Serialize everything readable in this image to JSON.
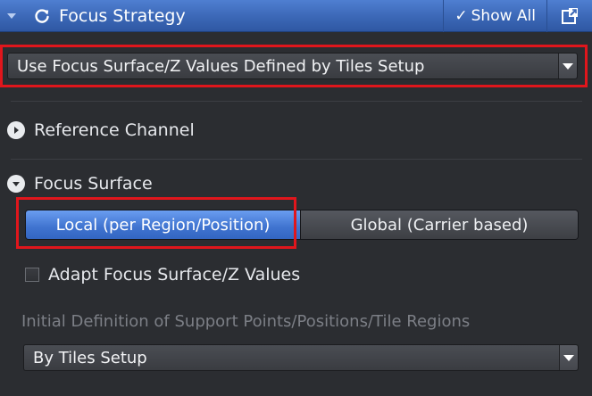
{
  "header": {
    "title": "Focus Strategy",
    "show_all_label": "Show All",
    "check_glyph": "✓",
    "icons": [
      "collapse-triangle-icon",
      "refresh-icon",
      "checkmark-icon",
      "popout-icon"
    ],
    "background": "#3b67b6"
  },
  "strategy_select": {
    "value": "Use Focus Surface/Z Values Defined by Tiles Setup"
  },
  "reference_channel": {
    "label": "Reference Channel",
    "expanded": false
  },
  "focus_surface": {
    "label": "Focus Surface",
    "expanded": true,
    "options": [
      {
        "label": "Local (per Region/Position)",
        "selected": true
      },
      {
        "label": "Global (Carrier based)",
        "selected": false
      }
    ]
  },
  "adapt_checkbox": {
    "label": "Adapt Focus Surface/Z Values",
    "checked": false
  },
  "support_points": {
    "label": "Initial Definition of Support Points/Positions/Tile Regions",
    "value": "By Tiles Setup"
  },
  "colors": {
    "highlight_box": "#e0161c",
    "selected_segment": "#3f73cf",
    "panel_background": "#2b2d31"
  }
}
